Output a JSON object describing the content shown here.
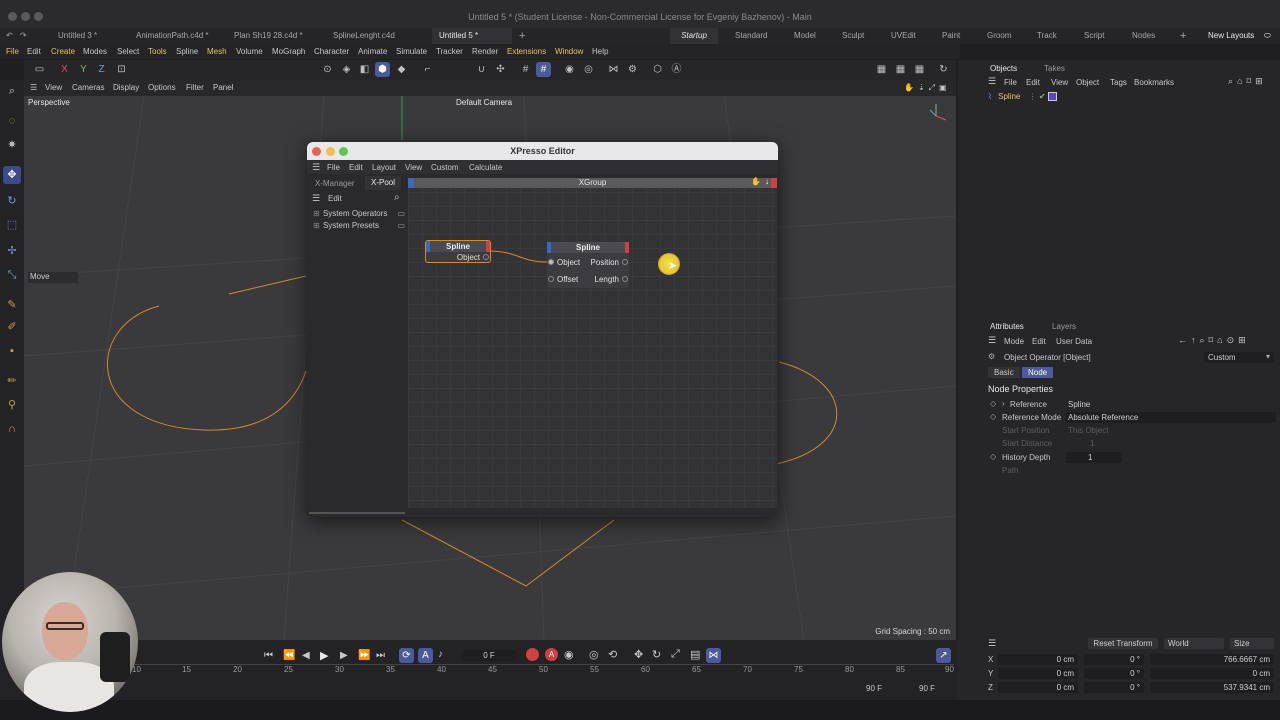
{
  "window": {
    "title": "Untitled 5 * (Student License - Non-Commercial License for Evgeniy Bazhenov) - Main"
  },
  "doc_tabs": [
    "Untitled 3 *",
    "AnimationPath.c4d *",
    "Plan Sh19 28.c4d *",
    "SplineLenght.c4d",
    "Untitled 5 *"
  ],
  "layout_tabs": [
    "Startup",
    "Standard",
    "Model",
    "Sculpt",
    "UVEdit",
    "Paint",
    "Groom",
    "Track",
    "Script",
    "Nodes"
  ],
  "new_layouts": "New Layouts",
  "menu": [
    "File",
    "Edit",
    "Create",
    "Modes",
    "Select",
    "Tools",
    "Spline",
    "Mesh",
    "Volume",
    "MoGraph",
    "Character",
    "Animate",
    "Simulate",
    "Tracker",
    "Render",
    "Extensions",
    "Window",
    "Help"
  ],
  "toolbar": {
    "x": "X",
    "y": "Y",
    "z": "Z"
  },
  "viewport": {
    "menu": [
      "View",
      "Cameras",
      "Display",
      "Options",
      "Filter",
      "Panel"
    ],
    "label": "Perspective",
    "camera": "Default Camera",
    "grid_spacing": "Grid Spacing : 50 cm",
    "move_label": "Move"
  },
  "xpresso": {
    "title": "XPresso Editor",
    "menu": [
      "File",
      "Edit",
      "Layout",
      "View",
      "Custom",
      "Calculate"
    ],
    "tabs": [
      "X-Manager",
      "X-Pool"
    ],
    "pool_edit": "Edit",
    "pool_items": [
      "System Operators",
      "System Presets"
    ],
    "group_title": "XGroup",
    "node1": {
      "title": "Spline",
      "port": "Object"
    },
    "node2": {
      "title": "Spline",
      "in_ports": [
        "Object",
        "Offset"
      ],
      "out_ports": [
        "Position",
        "Length"
      ]
    }
  },
  "objects_panel": {
    "tabs": [
      "Objects",
      "Takes"
    ],
    "menu": [
      "File",
      "Edit",
      "View",
      "Object",
      "Tags",
      "Bookmarks"
    ],
    "items": [
      {
        "name": "Spline"
      }
    ]
  },
  "attributes_panel": {
    "tabs": [
      "Attributes",
      "Layers"
    ],
    "menu": [
      "Mode",
      "Edit",
      "User Data"
    ],
    "object_title": "Object Operator [Object]",
    "mode_select": "Custom",
    "sub_tabs": [
      "Basic",
      "Node"
    ],
    "section": "Node Properties",
    "props": [
      {
        "label": "Reference",
        "value": "Spline",
        "enabled": true
      },
      {
        "label": "Reference Mode",
        "value": "Absolute Reference",
        "enabled": true
      },
      {
        "label": "Start Position",
        "value": "This Object",
        "enabled": false
      },
      {
        "label": "Start Distance",
        "value": "1",
        "enabled": false
      },
      {
        "label": "History Depth",
        "value": "1",
        "enabled": true
      },
      {
        "label": "Path",
        "value": "",
        "enabled": false
      }
    ]
  },
  "coordinates": {
    "reset": "Reset Transform",
    "space": "World",
    "mode": "Size",
    "rows": [
      {
        "axis": "X",
        "pos": "0 cm",
        "rot": "0 °",
        "size": "766.6667 cm"
      },
      {
        "axis": "Y",
        "pos": "0 cm",
        "rot": "0 °",
        "size": "0 cm"
      },
      {
        "axis": "Z",
        "pos": "0 cm",
        "rot": "0 °",
        "size": "537.9341 cm"
      }
    ]
  },
  "timeline": {
    "ticks": [
      "10",
      "15",
      "20",
      "25",
      "30",
      "35",
      "40",
      "45",
      "50",
      "55",
      "60",
      "65",
      "70",
      "75",
      "80",
      "85",
      "90"
    ],
    "current_frame": "0 F",
    "end_frame_a": "90 F",
    "end_frame_b": "90 F"
  }
}
